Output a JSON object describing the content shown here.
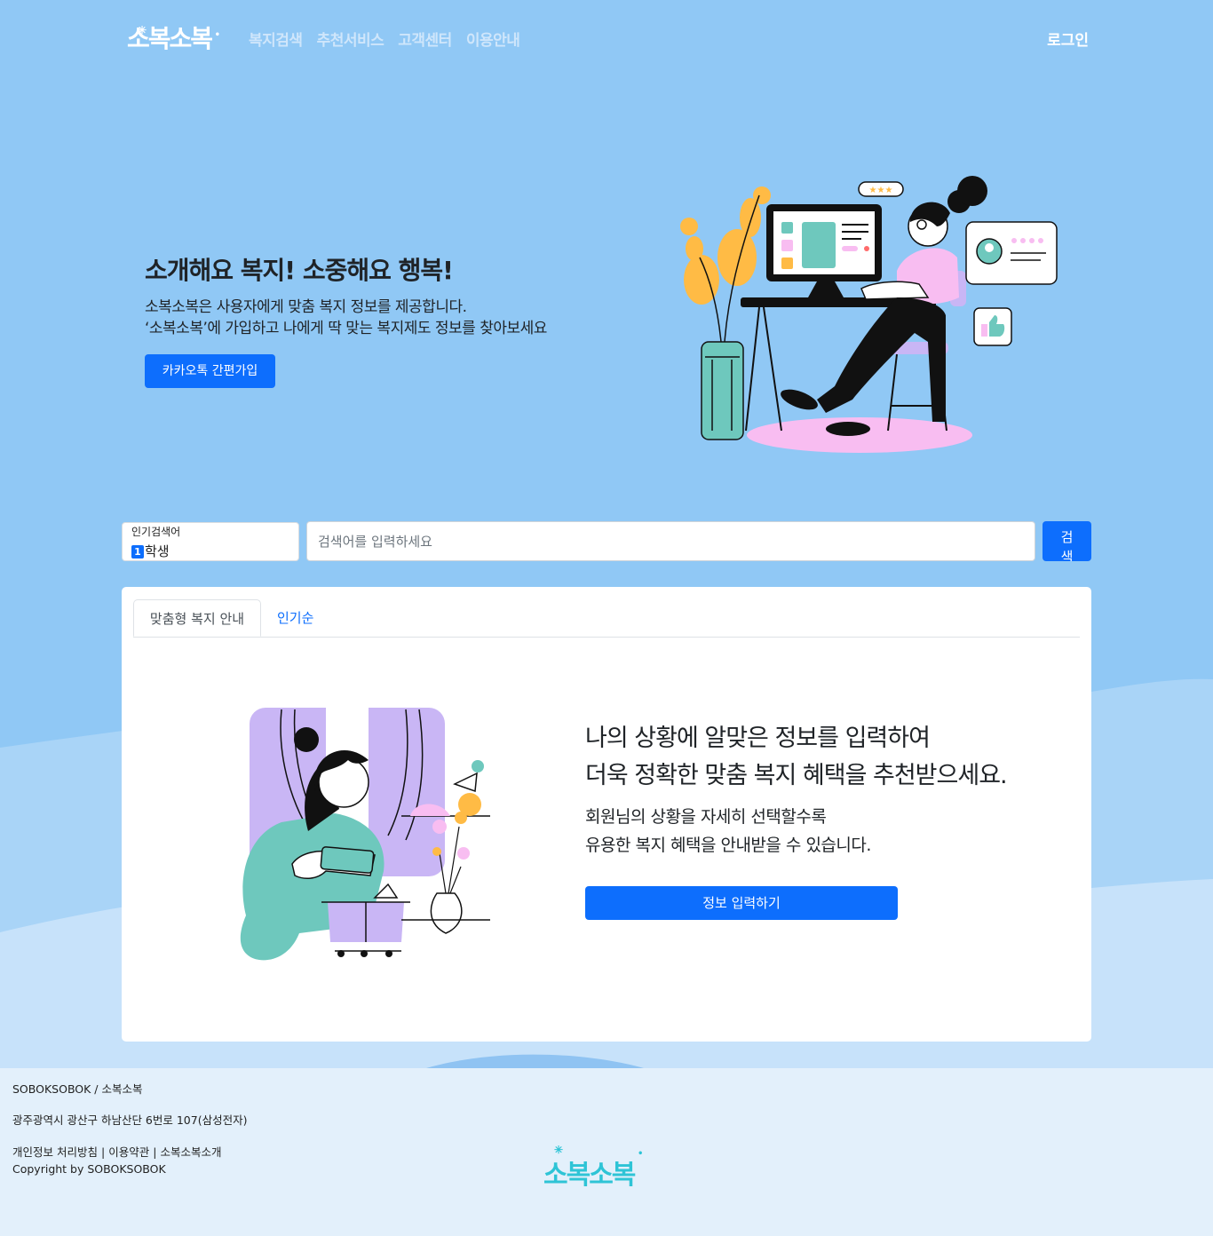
{
  "header": {
    "logo": "소복소복",
    "nav": [
      "복지검색",
      "추천서비스",
      "고객센터",
      "이용안내"
    ],
    "login": "로그인"
  },
  "hero": {
    "title": "소개해요 복지! 소중해요 행복!",
    "sub1": "소복소복은 사용자에게 맞춤 복지 정보를 제공합니다.",
    "sub2": "‘소복소복’에 가입하고 나에게 딱 맞는 복지제도 정보를 찾아보세요",
    "button": "카카오톡 간편가입"
  },
  "search": {
    "popular_label": "인기검색어",
    "popular_rank": "1",
    "popular_term": "학생",
    "placeholder": "검색어를 입력하세요",
    "button": "검색"
  },
  "tabs": [
    "맞춤형 복지 안내",
    "인기순"
  ],
  "card": {
    "title1": "나의 상황에 알맞은 정보를 입력하여",
    "title2": "더욱 정확한 맞춤 복지 혜택을 추천받으세요.",
    "desc1": "회원님의 상황을 자세히 선택할수록",
    "desc2": "유용한 복지 혜택을 안내받을 수 있습니다.",
    "button": "정보 입력하기"
  },
  "footer": {
    "brand": "SOBOKSOBOK / 소복소복",
    "address": "광주광역시 광산구 하남산단 6번로 107(삼성전자)",
    "links": [
      "개인정보 처리방침",
      "|",
      "이용약관",
      "|",
      "소복소복소개"
    ],
    "copyright": "Copyright by SOBOKSOBOK",
    "logo": "소복소복"
  },
  "colors": {
    "accent": "#0d6efd",
    "hero_bg": "#90c8f5",
    "footer_bg": "#e3f0fb",
    "footer_logo": "#2ec4d6"
  }
}
